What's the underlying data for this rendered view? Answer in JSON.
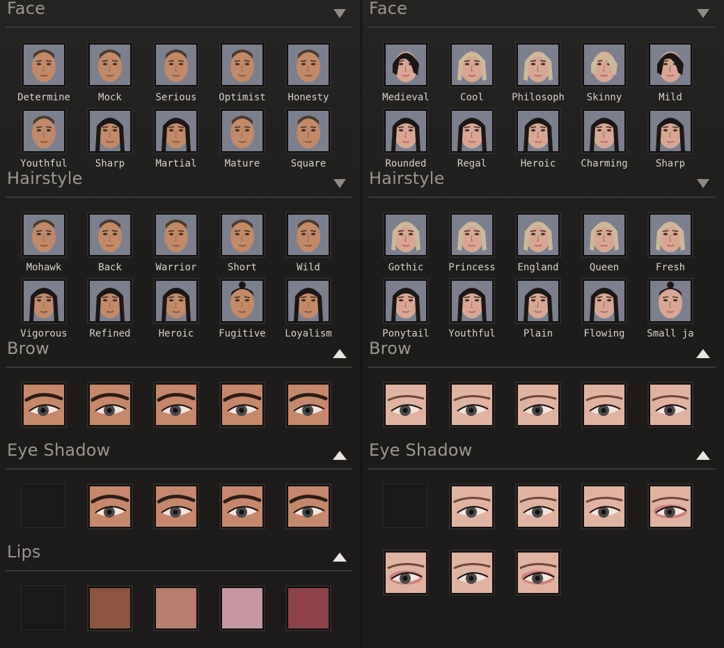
{
  "left": {
    "face": {
      "title": "Face",
      "items": [
        "Determine",
        "Mock",
        "Serious",
        "Optimist",
        "Honesty",
        "Youthful",
        "Sharp",
        "Martial",
        "Mature",
        "Square"
      ]
    },
    "hairstyle": {
      "title": "Hairstyle",
      "items": [
        "Mohawk",
        "Back",
        "Warrior",
        "Short",
        "Wild",
        "Vigorous",
        "Refined",
        "Heroic",
        "Fugitive",
        "Loyalism"
      ]
    },
    "brow": {
      "title": "Brow",
      "count": 5
    },
    "eye_shadow": {
      "title": "Eye Shadow",
      "count": 4
    },
    "lips": {
      "title": "Lips",
      "colors": [
        "#8b5540",
        "#b67f6e",
        "#c497a2",
        "#8e434a"
      ]
    }
  },
  "right": {
    "face": {
      "title": "Face",
      "items": [
        "Medieval",
        "Cool",
        "Philosoph",
        "Skinny",
        "Mild",
        "Rounded",
        "Regal",
        "Heroic",
        "Charming",
        "Sharp"
      ]
    },
    "hairstyle": {
      "title": "Hairstyle",
      "items": [
        "Gothic",
        "Princess",
        "England",
        "Queen",
        "Fresh",
        "Ponytail",
        "Youthful",
        "Plain",
        "Flowing",
        "Small ja"
      ]
    },
    "brow": {
      "title": "Brow",
      "count": 5
    },
    "eye_shadow": {
      "title": "Eye Shadow",
      "count": 7
    }
  },
  "colors": {
    "skin_male": "#c28a68",
    "skin_female": "#d8a793",
    "hair_dark": "#1b1716",
    "hair_blonde": "#cbb99a",
    "thumb_bg": "#7b7f8e",
    "eye_shadow_red": "#b84a54"
  },
  "icons": {
    "collapsed": "chevron-down-icon",
    "expanded": "triangle-up-icon"
  }
}
